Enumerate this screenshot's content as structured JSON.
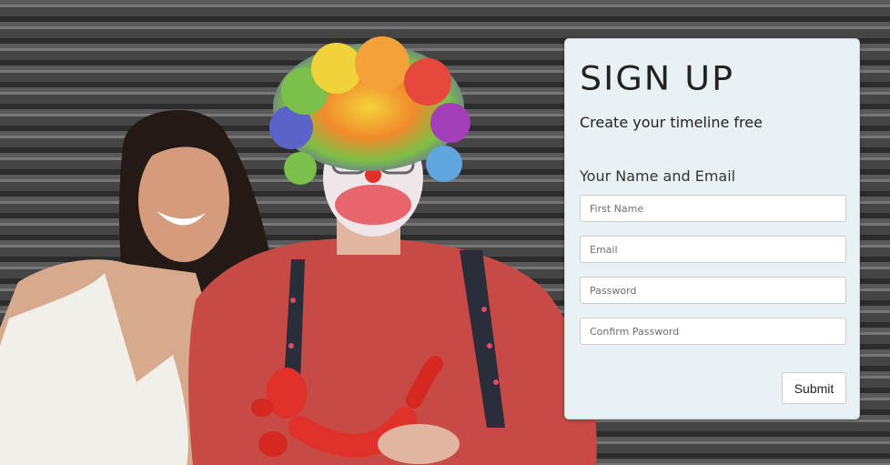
{
  "signup": {
    "title": "SIGN UP",
    "subtitle": "Create your timeline free",
    "section_heading": "Your Name and Email",
    "fields": {
      "first_name": {
        "placeholder": "First Name",
        "value": ""
      },
      "email": {
        "placeholder": "Email",
        "value": ""
      },
      "password": {
        "placeholder": "Password",
        "value": ""
      },
      "confirm_password": {
        "placeholder": "Confirm Password",
        "value": ""
      }
    },
    "submit_label": "Submit"
  },
  "colors": {
    "card_background": "#eaf1f4",
    "shutter_background": "#3c3c3c",
    "clown_shirt": "#c84a45",
    "balloon": "#e0302a"
  }
}
